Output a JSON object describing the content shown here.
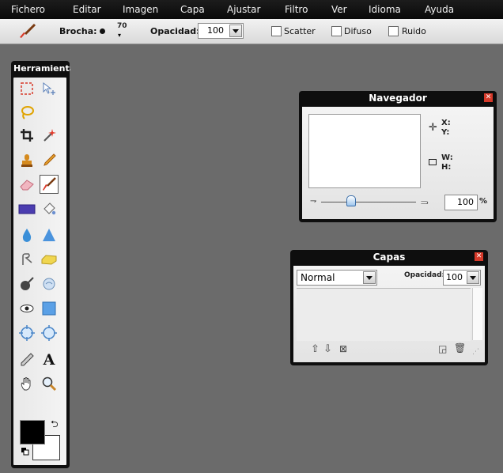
{
  "menu": [
    "Fichero",
    "Editar",
    "Imagen",
    "Capa",
    "Ajustar",
    "Filtro",
    "Ver",
    "Idioma",
    "Ayuda"
  ],
  "options": {
    "brush_label": "Brocha:",
    "brush_size": "70",
    "opacity_label": "Opacidad:",
    "opacity_value": "100",
    "scatter_label": "Scatter",
    "blur_label": "Difuso",
    "noise_label": "Ruido"
  },
  "tools_panel": {
    "title": "Herramientas"
  },
  "navigator": {
    "title": "Navegador",
    "x_label": "X:",
    "y_label": "Y:",
    "w_label": "W:",
    "h_label": "H:",
    "zoom_value": "100",
    "zoom_unit": "%"
  },
  "layers": {
    "title": "Capas",
    "blend_mode": "Normal",
    "opacity_label": "Opacidad:",
    "opacity_value": "100"
  },
  "colors": {
    "foreground": "#000000",
    "background": "#ffffff",
    "desktop": "#6b6b6b"
  }
}
